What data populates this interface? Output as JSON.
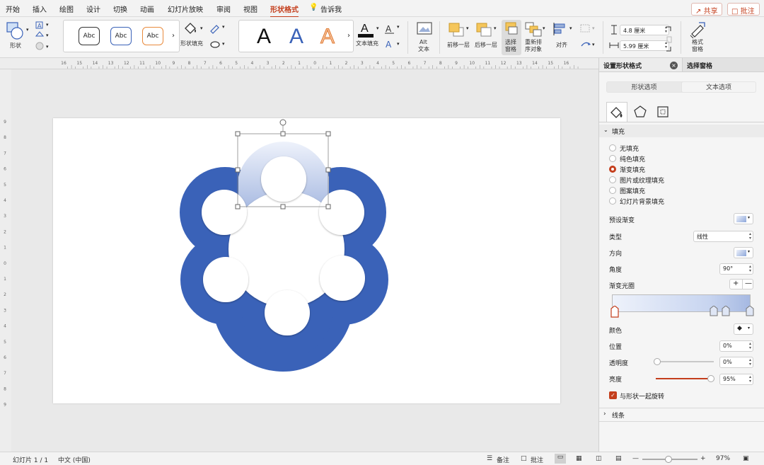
{
  "menu": {
    "tabs": [
      "开始",
      "插入",
      "绘图",
      "设计",
      "切换",
      "动画",
      "幻灯片放映",
      "审阅",
      "视图",
      "形状格式"
    ],
    "tell_me": "告诉我",
    "share": "共享",
    "comments": "批注"
  },
  "ribbon": {
    "shape_label": "形状",
    "shape_fill_label": "形状填充",
    "style_presets": [
      "Abc",
      "Abc",
      "Abc"
    ],
    "wordart_presets": [
      "A",
      "A",
      "A"
    ],
    "text_fill_label": "文本填充",
    "alt_text_line1": "Alt",
    "alt_text_line2": "文本",
    "bring_forward": "前移一层",
    "send_backward": "后移一层",
    "selection_pane_line1": "选择",
    "selection_pane_line2": "窗格",
    "reorder_line1": "重新排",
    "reorder_line2": "序对象",
    "align": "对齐",
    "height_value": "4.8 厘米",
    "width_value": "5.99 厘米",
    "format_pane_line1": "格式",
    "format_pane_line2": "窗格"
  },
  "ruler": {
    "labels": [
      "16",
      "15",
      "14",
      "13",
      "12",
      "11",
      "10",
      "9",
      "8",
      "7",
      "6",
      "5",
      "4",
      "3",
      "2",
      "1",
      "0",
      "1",
      "2",
      "3",
      "4",
      "5",
      "6",
      "7",
      "8",
      "9",
      "10",
      "11",
      "12",
      "13",
      "14",
      "15",
      "16"
    ],
    "v_labels": [
      "9",
      "8",
      "7",
      "6",
      "5",
      "4",
      "3",
      "2",
      "1",
      "0",
      "1",
      "2",
      "3",
      "4",
      "5",
      "6",
      "7",
      "8",
      "9"
    ]
  },
  "pane": {
    "title": "设置形状格式",
    "other_tab": "选择窗格",
    "sub_tabs": [
      "形状选项",
      "文本选项"
    ],
    "fill_section": "填充",
    "fill_options": [
      "无填充",
      "纯色填充",
      "渐变填充",
      "图片或纹理填充",
      "图案填充",
      "幻灯片背景填充"
    ],
    "selected_fill": "渐变填充",
    "preset_gradient": "预设渐变",
    "type_label": "类型",
    "type_value": "线性",
    "direction_label": "方向",
    "angle_label": "角度",
    "angle_value": "90°",
    "gradient_stops_label": "渐变光圈",
    "color_label": "颜色",
    "position_label": "位置",
    "position_value": "0%",
    "transparency_label": "透明度",
    "transparency_value": "0%",
    "transparency_level": 0,
    "brightness_label": "亮度",
    "brightness_value": "95%",
    "brightness_level": 0.95,
    "rotate_with_shape": "与形状一起旋转",
    "rotate_checked": true,
    "line_section": "线条"
  },
  "status": {
    "slide_counter": "幻灯片 1 / 1",
    "language": "中文 (中国)",
    "notes": "备注",
    "comments": "批注",
    "zoom": "97%"
  },
  "colors": {
    "accent": "#c43e1c",
    "flower_blue": "#3a62b8",
    "gradient_light": "#e8eefa",
    "gradient_blue": "#aebfe4"
  }
}
